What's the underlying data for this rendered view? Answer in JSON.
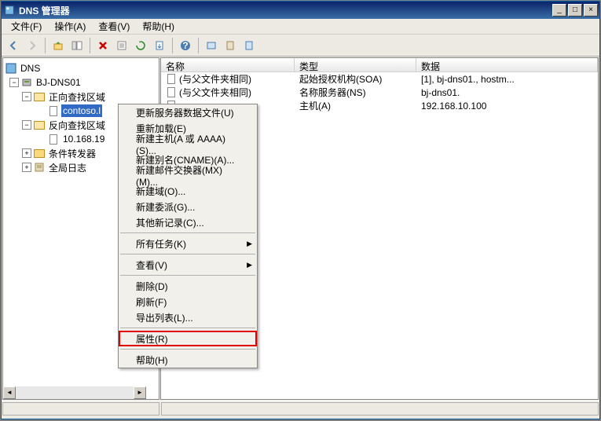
{
  "window": {
    "title": "DNS 管理器"
  },
  "menubar": [
    "文件(F)",
    "操作(A)",
    "查看(V)",
    "帮助(H)"
  ],
  "tree": {
    "root": "DNS",
    "server": "BJ-DNS01",
    "forward_zone": "正向查找区域",
    "selected_zone": "contoso.l",
    "reverse_zone": "反向查找区域",
    "reverse_item": "10.168.19",
    "forwarders": "条件转发器",
    "global_log": "全局日志"
  },
  "list": {
    "columns": [
      "名称",
      "类型",
      "数据"
    ],
    "rows": [
      {
        "name": "(与父文件夹相同)",
        "type": "起始授权机构(SOA)",
        "data": "[1], bj-dns01., hostm..."
      },
      {
        "name": "(与父文件夹相同)",
        "type": "名称服务器(NS)",
        "data": "bj-dns01."
      },
      {
        "name": "",
        "type": "主机(A)",
        "data": "192.168.10.100"
      }
    ]
  },
  "context_menu": {
    "items": [
      {
        "label": "更新服务器数据文件(U)",
        "type": "item"
      },
      {
        "label": "重新加载(E)",
        "type": "item"
      },
      {
        "label": "新建主机(A 或 AAAA)(S)...",
        "type": "item"
      },
      {
        "label": "新建别名(CNAME)(A)...",
        "type": "item"
      },
      {
        "label": "新建邮件交换器(MX)(M)...",
        "type": "item"
      },
      {
        "label": "新建域(O)...",
        "type": "item"
      },
      {
        "label": "新建委派(G)...",
        "type": "item"
      },
      {
        "label": "其他新记录(C)...",
        "type": "item"
      },
      {
        "type": "sep"
      },
      {
        "label": "所有任务(K)",
        "type": "submenu"
      },
      {
        "type": "sep"
      },
      {
        "label": "查看(V)",
        "type": "submenu"
      },
      {
        "type": "sep"
      },
      {
        "label": "删除(D)",
        "type": "item"
      },
      {
        "label": "刷新(F)",
        "type": "item"
      },
      {
        "label": "导出列表(L)...",
        "type": "item"
      },
      {
        "type": "sep"
      },
      {
        "label": "属性(R)",
        "type": "item",
        "highlighted": true
      },
      {
        "type": "sep"
      },
      {
        "label": "帮助(H)",
        "type": "item"
      }
    ]
  }
}
